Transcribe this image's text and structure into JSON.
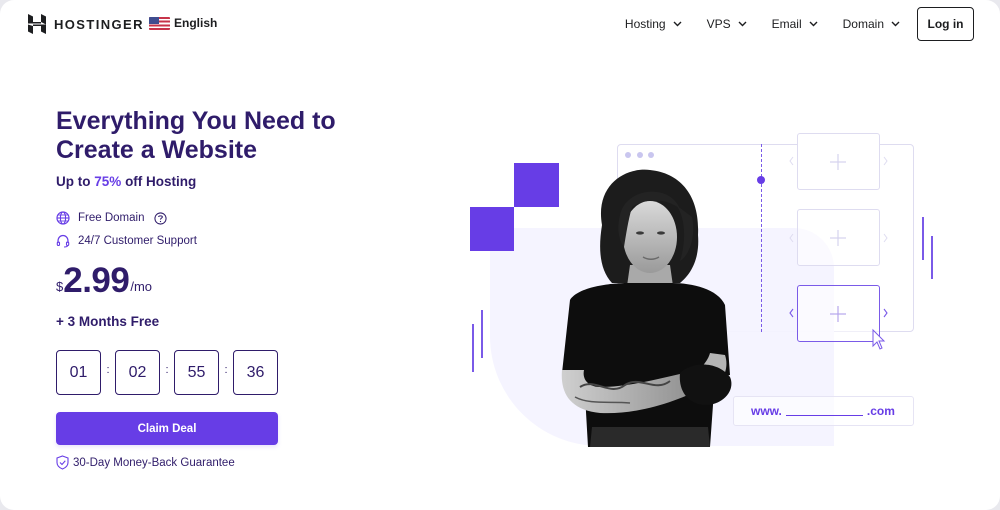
{
  "header": {
    "brand": "HOSTINGER",
    "language": {
      "label": "English",
      "flag": "us-flag-icon"
    },
    "nav": [
      {
        "label": "Hosting",
        "icon": "chevron-down-icon"
      },
      {
        "label": "VPS",
        "icon": "chevron-down-icon"
      },
      {
        "label": "Email",
        "icon": "chevron-down-icon"
      },
      {
        "label": "Domain",
        "icon": "chevron-down-icon"
      }
    ],
    "login_label": "Log in"
  },
  "hero": {
    "title_line1": "Everything You Need to",
    "title_line2": "Create a Website",
    "discount_prefix": "Up to",
    "discount_value": "75%",
    "discount_suffix": "off Hosting",
    "features": [
      {
        "label": "Free Domain",
        "icon": "globe-icon",
        "help_icon": "help-circle-icon"
      },
      {
        "label": "24/7 Customer Support",
        "icon": "headset-icon"
      }
    ],
    "price": {
      "currency": "$",
      "amount": "2.99",
      "period": "/mo"
    },
    "bonus": "+ 3 Months Free",
    "countdown": {
      "days": "01",
      "hours": "02",
      "minutes": "55",
      "seconds": "36",
      "separator": ":"
    },
    "cta_label": "Claim Deal",
    "guarantee": "30-Day Money-Back Guarantee"
  },
  "illustration": {
    "domain_prefix": "www.",
    "domain_suffix": ".com",
    "colors": {
      "accent": "#673de6",
      "tint": "#f4f3ff",
      "outline": "#dcdaf0"
    }
  }
}
